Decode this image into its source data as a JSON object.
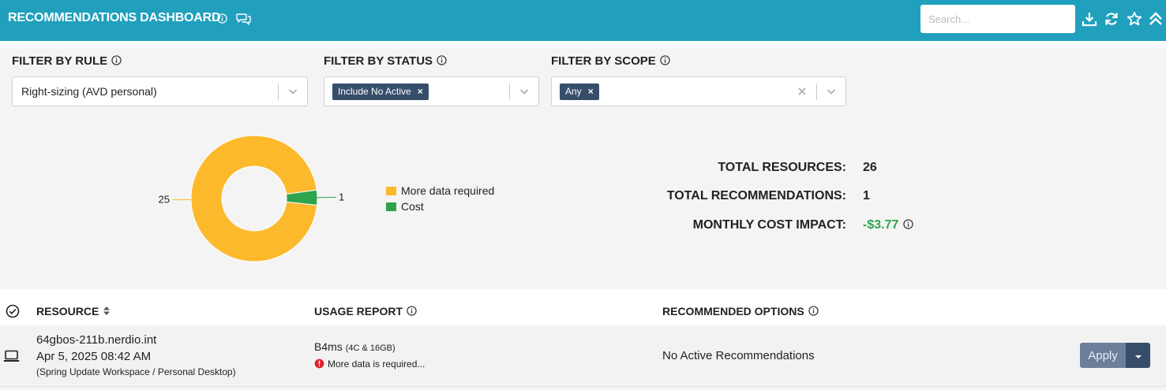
{
  "header": {
    "title": "RECOMMENDATIONS DASHBOARD",
    "search_placeholder": "Search..."
  },
  "filters": {
    "rule": {
      "label": "FILTER BY RULE",
      "value": "Right-sizing (AVD personal)"
    },
    "status": {
      "label": "FILTER BY STATUS",
      "tag": "Include No Active"
    },
    "scope": {
      "label": "FILTER BY SCOPE",
      "tag": "Any"
    }
  },
  "chart_data": {
    "type": "pie",
    "donut": true,
    "slices": [
      {
        "label": "More data required",
        "value": 25,
        "color": "#fdb92c"
      },
      {
        "label": "Cost",
        "value": 1,
        "color": "#2ea44f"
      }
    ],
    "legend_position": "right"
  },
  "stats": {
    "total_resources_label": "TOTAL RESOURCES:",
    "total_resources": "26",
    "total_recommendations_label": "TOTAL RECOMMENDATIONS:",
    "total_recommendations": "1",
    "monthly_cost_label": "MONTHLY COST IMPACT:",
    "monthly_cost": "-$3.77"
  },
  "table": {
    "columns": {
      "resource": "RESOURCE",
      "usage": "USAGE REPORT",
      "options": "RECOMMENDED OPTIONS"
    },
    "rows": [
      {
        "name": "64gbos-211b.nerdio.int",
        "date": "Apr 5, 2025 08:42 AM",
        "path": "(Spring Update Workspace / Personal Desktop)",
        "size": "B4ms",
        "size_detail": "(4C & 16GB)",
        "usage_note": "More data is required...",
        "recommendation": "No Active Recommendations",
        "action": "Apply"
      }
    ]
  }
}
